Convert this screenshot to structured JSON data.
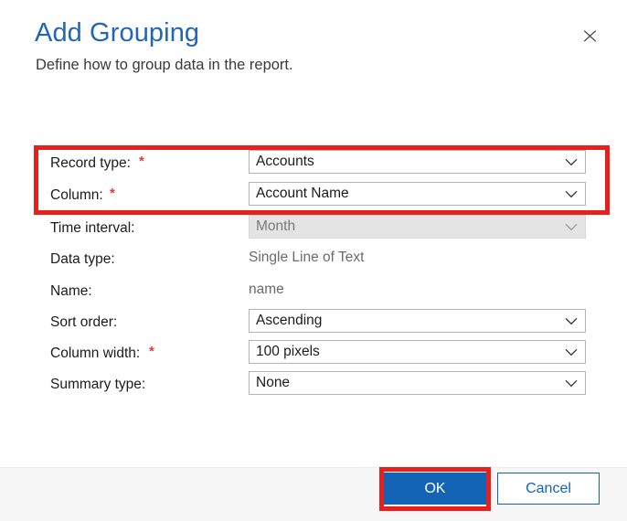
{
  "dialog": {
    "title": "Add Grouping",
    "subtitle": "Define how to group data in the report.",
    "close_icon": "close-icon"
  },
  "form": {
    "required_marker": "*",
    "rows": [
      {
        "label": "Record type:",
        "required": true,
        "control": "dropdown",
        "value": "Accounts",
        "disabled": false,
        "name": "record-type"
      },
      {
        "label": "Column:",
        "required": true,
        "control": "dropdown",
        "value": "Account Name",
        "disabled": false,
        "name": "column"
      },
      {
        "label": "Time interval:",
        "required": false,
        "control": "dropdown",
        "value": "Month",
        "disabled": true,
        "name": "time-interval"
      },
      {
        "label": "Data type:",
        "required": false,
        "control": "readonly",
        "value": "Single Line of Text",
        "disabled": false,
        "name": "data-type"
      },
      {
        "label": "Name:",
        "required": false,
        "control": "readonly",
        "value": "name",
        "disabled": false,
        "name": "name"
      },
      {
        "label": "Sort order:",
        "required": false,
        "control": "dropdown",
        "value": "Ascending",
        "disabled": false,
        "name": "sort-order"
      },
      {
        "label": "Column width:",
        "required": true,
        "control": "dropdown",
        "value": "100 pixels",
        "disabled": false,
        "name": "column-width"
      },
      {
        "label": "Summary type:",
        "required": false,
        "control": "dropdown",
        "value": "None",
        "disabled": false,
        "name": "summary-type"
      }
    ]
  },
  "footer": {
    "ok_label": "OK",
    "cancel_label": "Cancel"
  },
  "annotations": [
    {
      "name": "highlight-record-type-and-column"
    },
    {
      "name": "highlight-ok-button"
    }
  ],
  "colors": {
    "title_blue": "#2266bb",
    "accent_blue": "#1363b6",
    "required_red": "#e03a32",
    "annotation_red": "#e8201d",
    "footer_bg": "#f7f7f7",
    "disabled_bg": "#e4e4e4"
  }
}
